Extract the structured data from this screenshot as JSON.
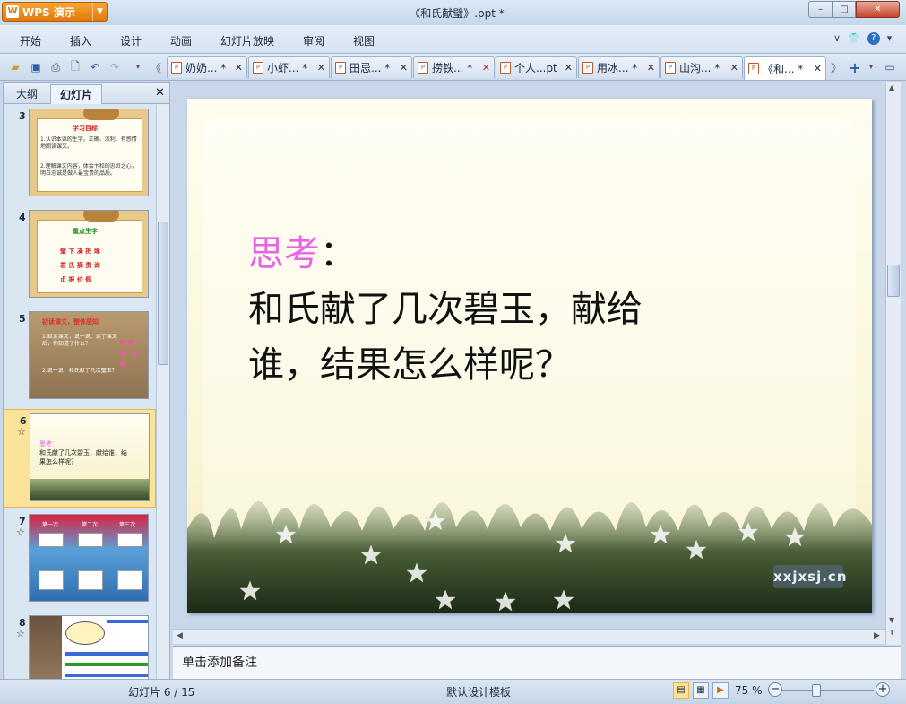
{
  "app": {
    "button_label": "WPS 演示",
    "window_title": "《和氏献璧》.ppt *"
  },
  "window_controls": {
    "minimize": "–",
    "maximize": "□",
    "close": "✕"
  },
  "menu": {
    "items": [
      "开始",
      "插入",
      "设计",
      "动画",
      "幻灯片放映",
      "审阅",
      "视图"
    ]
  },
  "tabs": [
    {
      "label": "奶奶... *"
    },
    {
      "label": "小虾... *"
    },
    {
      "label": "田忌... *"
    },
    {
      "label": "捞铁... *",
      "close_hover": true
    },
    {
      "label": "个人...pt"
    },
    {
      "label": "用冰... *"
    },
    {
      "label": "山沟... *"
    },
    {
      "label": "《和... *",
      "active": true
    }
  ],
  "left_panel": {
    "tabs": [
      "大纲",
      "幻灯片"
    ],
    "active_tab": "幻灯片",
    "thumbnails": [
      {
        "number": "3",
        "star": false,
        "heading": "学习目标",
        "lines": [
          "1.认识本课的生字。正确、流利、有感情地朗读课文。",
          "2.理解课文内容，体会卞和的忠贞之心，明白忠诚是做人最宝贵的品质。"
        ]
      },
      {
        "number": "4",
        "star": false,
        "heading": "重点生字",
        "lines": [
          "璧 卞 凑 把 琢",
          "君 氏 摘 责 询",
          "贞 报 价 假"
        ]
      },
      {
        "number": "5",
        "star": false,
        "heading": "初读课文，整体感知",
        "lines": [
          "1.默读课文，说一说：读了课文后，你知道了什么？",
          "2.说一说：和氏献了几次璧玉？"
        ]
      },
      {
        "number": "6",
        "star": true,
        "selected": true,
        "heading": "思考：",
        "lines": [
          "和氏献了几次碧玉，献给谁，结果怎么样呢？"
        ]
      },
      {
        "number": "7",
        "star": true,
        "heading": "",
        "lines": [
          "第一次",
          "第二次",
          "第三次"
        ]
      },
      {
        "number": "8",
        "star": true,
        "heading": "",
        "lines": []
      }
    ]
  },
  "slide": {
    "title_word": "思考",
    "title_colon": "：",
    "body_line1": "和氏献了几次碧玉，献给",
    "body_line2": "谁，结果怎么样呢？",
    "watermark": "xxjxsj.cn",
    "title_color": "#e665e6"
  },
  "notes": {
    "placeholder": "单击添加备注"
  },
  "status": {
    "slide_info": "幻灯片 6 / 15",
    "template": "默认设计模板",
    "zoom": "75 %",
    "zoom_level_percent": 75
  }
}
